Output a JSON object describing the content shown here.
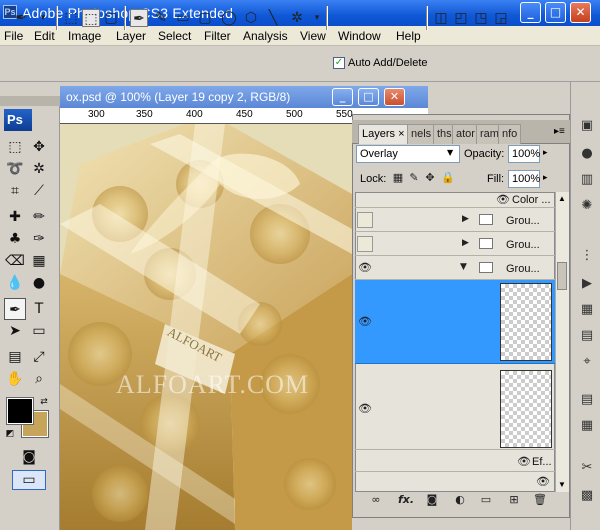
{
  "window": {
    "app_title": "Adobe Photoshop CS3 Extended",
    "minimize": "_",
    "maximize": "□",
    "close": "✕"
  },
  "menu": [
    "File",
    "Edit",
    "Image",
    "Layer",
    "Select",
    "Filter",
    "Analysis",
    "View",
    "Window",
    "Help"
  ],
  "options_bar": {
    "auto_add_delete": "Auto Add/Delete",
    "auto_add_checked": true
  },
  "toolbox": {
    "badge": "Ps",
    "foreground_color": "#000000",
    "background_color": "#c6a55a"
  },
  "document": {
    "title": "ox.psd @ 100% (Layer 19 copy 2, RGB/8)",
    "ruler_ticks": [
      "300",
      "350",
      "400",
      "450",
      "500",
      "550"
    ],
    "watermark": "ALFOART.COM",
    "box_label": "ALFOART"
  },
  "layers_panel": {
    "tabs": [
      "Layers",
      "nels",
      "ths",
      "ator",
      "ram",
      "nfo"
    ],
    "close_tab": "×",
    "blend_mode": "Overlay",
    "opacity_label": "Opacity:",
    "opacity_value": "100%",
    "lock_label": "Lock:",
    "fill_label": "Fill:",
    "fill_value": "100%",
    "layers": [
      {
        "name": "Color ...",
        "kind": "effect"
      },
      {
        "name": "Grou...",
        "kind": "group",
        "expanded": false
      },
      {
        "name": "Grou...",
        "kind": "group",
        "expanded": false
      },
      {
        "name": "Grou...",
        "kind": "group",
        "expanded": true
      },
      {
        "name": "",
        "kind": "layer",
        "selected": true
      },
      {
        "name": "",
        "kind": "layer",
        "selected": false
      },
      {
        "name": "Ef...",
        "kind": "effect"
      }
    ],
    "selection_color": "#3399ff"
  },
  "icons": [
    "pen-tool-icon",
    "eye-icon",
    "folder-icon",
    "lock-icon",
    "trash-icon",
    "link-icon",
    "fx-icon",
    "mask-icon",
    "new-layer-icon"
  ]
}
